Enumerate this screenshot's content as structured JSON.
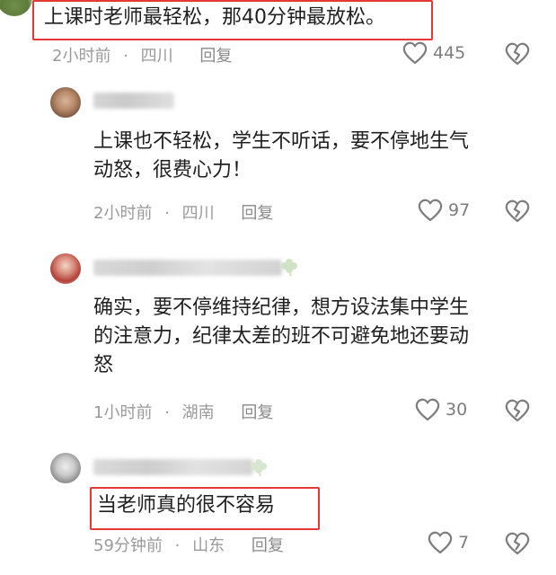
{
  "comments": [
    {
      "text": "上课时老师最轻松，那40分钟最放松。",
      "time": "2小时前",
      "location": "四川",
      "reply_label": "回复",
      "likes": "445"
    },
    {
      "text_lines": [
        "上课也不轻松，学生不听话，要不停地生气",
        "动怒，很费心力！"
      ],
      "time": "2小时前",
      "location": "四川",
      "reply_label": "回复",
      "likes": "97"
    },
    {
      "text_lines": [
        "确实，要不停维持纪律，想方设法集中学生",
        "的注意力，纪律太差的班不可避免地还要动",
        "怒"
      ],
      "time": "1小时前",
      "location": "湖南",
      "reply_label": "回复",
      "likes": "30"
    },
    {
      "text": "当老师真的很不容易",
      "time": "59分钟前",
      "location": "山东",
      "reply_label": "回复",
      "likes": "7"
    }
  ],
  "separator": "·",
  "icons": {
    "like": "heart-outline-icon",
    "dislike": "broken-heart-icon"
  },
  "colors": {
    "highlight_border": "#e53935",
    "meta_text": "#9a9a9a"
  }
}
